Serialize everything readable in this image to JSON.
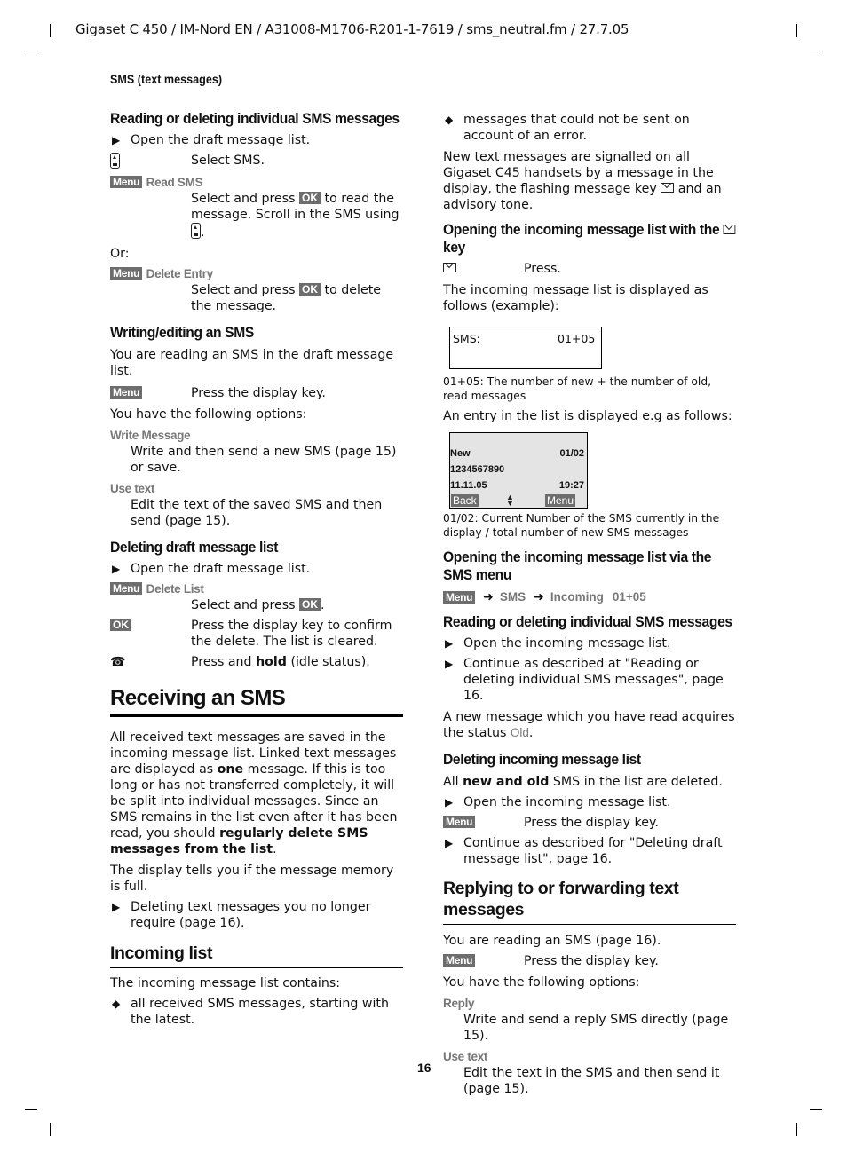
{
  "header": {
    "doc_ref": "Gigaset C 450 / IM-Nord EN / A31008-M1706-R201-1-7619 / sms_neutral.fm / 27.7.05",
    "running_head": "SMS (text messages)",
    "page_number": "16"
  },
  "left": {
    "reading_deleting": {
      "title": "Reading or deleting individual SMS messages",
      "bullet1": "Open the draft message list.",
      "step_select": "Select SMS.",
      "menu_key": "Menu",
      "read_sms_item": "Read SMS",
      "read_sms_txt_a": "Select and press ",
      "ok_key": "OK",
      "read_sms_txt_b": " to read the message. Scroll in the SMS using ",
      "read_sms_txt_c": ".",
      "or": "Or:",
      "delete_entry_item": "Delete Entry",
      "delete_entry_txt_a": "Select and press ",
      "delete_entry_txt_b": " to delete the message."
    },
    "writing": {
      "title": "Writing/editing an SMS",
      "intro": "You are reading an SMS in the draft message list.",
      "menu_key": "Menu",
      "press_display_key": "Press the display key.",
      "options_intro": "You have the following options:",
      "options": [
        {
          "label": "Write Message",
          "desc": "Write and then send a new SMS (page 15) or save."
        },
        {
          "label": "Use text",
          "desc": "Edit the text of the saved SMS and then send (page 15)."
        }
      ]
    },
    "deleting_draft": {
      "title": "Deleting draft message list",
      "bullet1": "Open the draft message list.",
      "menu_key": "Menu",
      "delete_list_item": "Delete List",
      "select_press": "Select and press ",
      "ok_key": "OK",
      "period": ".",
      "ok_step": "Press the display key to confirm the delete. The list is cleared.",
      "hold_a": "Press and ",
      "hold_b": "hold",
      "hold_c": " (idle status)."
    },
    "receiving": {
      "title": "Receiving an SMS",
      "para1_a": "All received text messages are saved in the incoming message list. Linked text messages are displayed as ",
      "para1_b": "one",
      "para1_c": " message. If this is too long or has not transferred completely, it will be split into individual messages. Since an SMS remains in the list even after it has been read, you should ",
      "para1_d": "regularly delete SMS messages from the list",
      "para1_e": ".",
      "para2": "The display tells you if the message memory is full.",
      "bullet1": "Deleting text messages you no longer require (page 16)."
    },
    "incoming_list": {
      "title": "Incoming list",
      "intro": "The incoming message list contains:",
      "item1": "all received SMS messages, starting with the latest."
    }
  },
  "right": {
    "item2": "messages that could not be sent on account of an error.",
    "signal_a": "New text messages are signalled on all Gigaset C45 handsets by a message in the display, the flashing message key ",
    "signal_b": " and an advisory tone.",
    "open_with_key": {
      "title_a": "Opening the incoming message list with the ",
      "title_b": " key",
      "press": "Press.",
      "displayed": "The incoming message list is displayed as follows (example):"
    },
    "lcd1": {
      "label": "SMS:",
      "count": "01+05"
    },
    "lcd1_caption": "01+05: The number of new + the number of old, read messages",
    "entry_intro": "An entry in the list is displayed e.g as follows:",
    "lcd2": {
      "status": "New",
      "index": "01/02",
      "number": "1234567890",
      "date": "11.11.05",
      "time": "19:27",
      "softkey_left": "Back",
      "softkey_right": "Menu"
    },
    "lcd2_caption": "01/02: Current Number of the SMS currently in the display / total number of new SMS messages",
    "via_menu": {
      "title": "Opening the incoming message list via the SMS menu",
      "path": [
        "Menu",
        "SMS",
        "Incoming",
        "01+05"
      ]
    },
    "reading_incoming": {
      "title": "Reading or deleting individual SMS messages",
      "bullet1": "Open the incoming message list.",
      "bullet2": "Continue as described at \"Reading or deleting individual SMS messages\", page 16.",
      "status_a": "A new message which you have read acquires the status ",
      "status_b": "Old",
      "status_c": "."
    },
    "deleting_incoming": {
      "title": "Deleting incoming message list",
      "intro_a": "All ",
      "intro_b": "new and old",
      "intro_c": " SMS in the list are deleted.",
      "bullet1": "Open the incoming message list.",
      "menu_key": "Menu",
      "press_display_key": "Press the display key.",
      "bullet2": "Continue as described for \"Deleting draft message list\", page 16."
    },
    "replying": {
      "title": "Replying to or forwarding text messages",
      "intro": "You are reading an SMS (page 16).",
      "menu_key": "Menu",
      "press_display_key": "Press the display key.",
      "options_intro": "You have the following options:",
      "options": [
        {
          "label": "Reply",
          "desc": "Write and send a reply SMS directly (page 15)."
        },
        {
          "label": "Use text",
          "desc": "Edit the text in the SMS and then send it (page 15)."
        }
      ]
    }
  }
}
